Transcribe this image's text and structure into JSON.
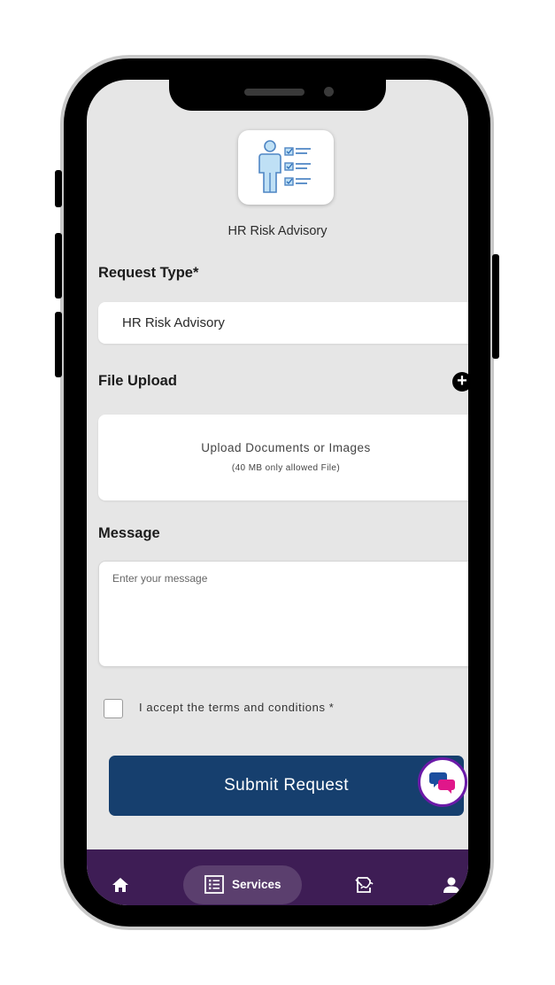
{
  "service": {
    "title": "HR Risk Advisory",
    "icon": "hr-checklist-icon"
  },
  "form": {
    "request_type": {
      "label": "Request Type*",
      "value": "HR Risk Advisory"
    },
    "file_upload": {
      "label": "File Upload",
      "add_icon": "plus-circle-icon",
      "dropzone_text": "Upload Documents or Images",
      "dropzone_subtext": "(40 MB only allowed File)"
    },
    "message": {
      "label": "Message",
      "placeholder": "Enter your message"
    },
    "terms": {
      "label": "I accept the terms and conditions *",
      "checked": false
    },
    "submit_label": "Submit Request"
  },
  "chat": {
    "icon": "chat-bubbles-icon"
  },
  "bottom_nav": {
    "items": [
      {
        "icon": "home-icon"
      },
      {
        "icon": "list-icon",
        "label": "Services",
        "active": true
      },
      {
        "icon": "document-sign-icon"
      },
      {
        "icon": "user-icon"
      }
    ]
  },
  "colors": {
    "primary": "#163f6e",
    "nav_bg": "#3e1d55",
    "chat_ring": "#6b1aa8",
    "screen_bg": "#e6e6e6"
  }
}
